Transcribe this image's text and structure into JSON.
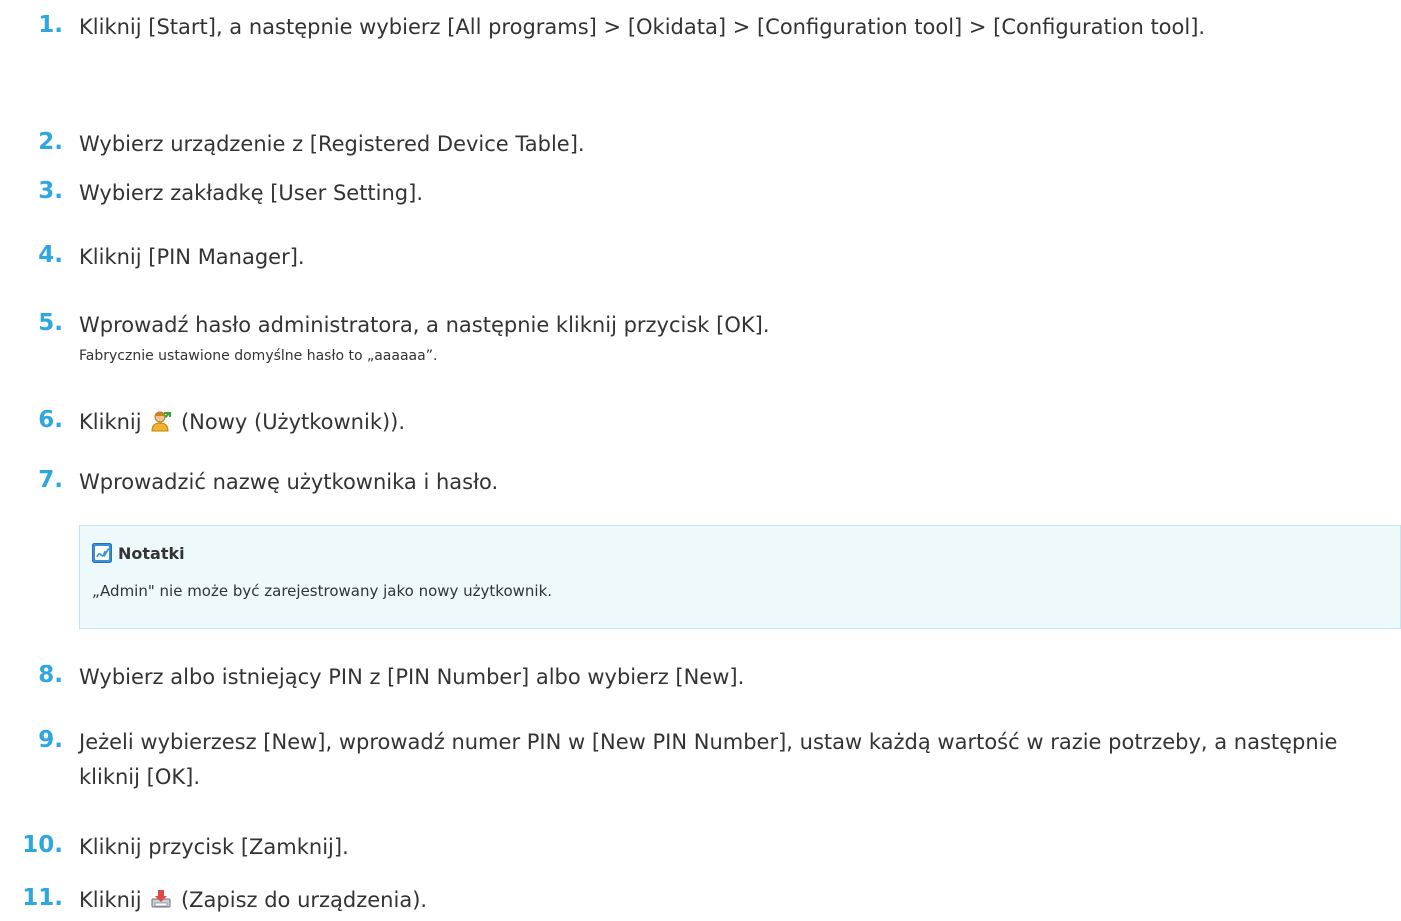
{
  "steps": [
    {
      "num": "1.",
      "text": "Kliknij [Start], a następnie wybierz [All programs] > [Okidata] > [Configuration tool] > [Configuration tool]."
    },
    {
      "num": "2.",
      "text": "Wybierz urządzenie z [Registered Device Table]."
    },
    {
      "num": "3.",
      "text": "Wybierz zakładkę [User Setting]."
    },
    {
      "num": "4.",
      "text": "Kliknij [PIN Manager]."
    },
    {
      "num": "5.",
      "text": "Wprowadź hasło administratora, a następnie kliknij przycisk [OK].",
      "sub": "Fabrycznie ustawione domyślne hasło to „aaaaaa”."
    },
    {
      "num": "6.",
      "before": "Kliknij",
      "icon": "new-user-icon",
      "after": "(Nowy (Użytkownik))."
    },
    {
      "num": "7.",
      "text": "Wprowadzić nazwę użytkownika i hasło."
    },
    {
      "num": "8.",
      "text": "Wybierz albo istniejący PIN z [PIN Number] albo wybierz [New]."
    },
    {
      "num": "9.",
      "text": "Jeżeli wybierzesz [New], wprowadź numer PIN w [New PIN Number], ustaw każdą wartość w razie potrzeby, a następnie kliknij [OK]."
    },
    {
      "num": "10.",
      "text": "Kliknij przycisk [Zamknij]."
    },
    {
      "num": "11.",
      "before": "Kliknij",
      "icon": "save-to-device-icon",
      "after": "(Zapisz do urządzenia)."
    }
  ],
  "note": {
    "icon": "memo-pen-icon",
    "title": "Notatki",
    "body": "„Admin\" nie może być zarejestrowany jako nowy użytkownik."
  },
  "colors": {
    "step_number": "#2ea7e0",
    "note_background": "#eef9fc",
    "note_border": "#bfe7f3"
  }
}
